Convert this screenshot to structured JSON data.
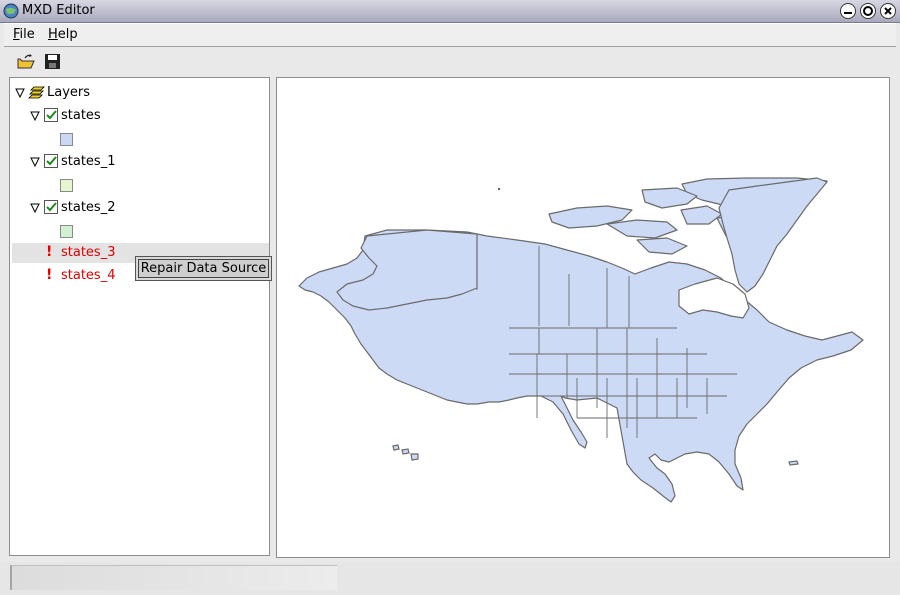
{
  "window": {
    "title": "MXD Editor"
  },
  "menu": {
    "file_label": "File",
    "help_label": "Help"
  },
  "tree": {
    "root_label": "Layers",
    "layers": [
      {
        "label": "states",
        "checked": true,
        "swatch_color": "#c9d9f3"
      },
      {
        "label": "states_1",
        "checked": true,
        "swatch_color": "#e6f6cf"
      },
      {
        "label": "states_2",
        "checked": true,
        "swatch_color": "#d3f0d3"
      },
      {
        "label": "states_3",
        "broken": true
      },
      {
        "label": "states_4",
        "broken": true
      }
    ]
  },
  "context_menu": {
    "repair_label": "Repair Data Source"
  },
  "colors": {
    "map_fill": "#cddaf6",
    "map_stroke": "#6a6a6a",
    "broken_text": "#e00000"
  }
}
